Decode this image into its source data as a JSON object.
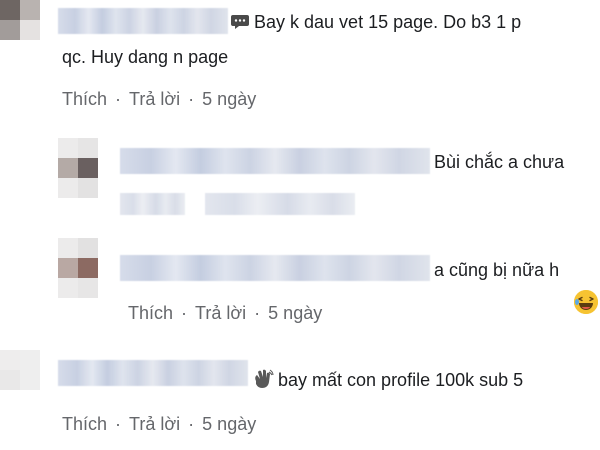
{
  "comments": [
    {
      "text_line1": "Bay k dau vet 15 page. Do b3 1 p",
      "text_line2": "qc. Huy dang n page",
      "icon": "speech-bubble-icon",
      "like": "Thích",
      "reply": "Trả lời",
      "time": "5 ngày"
    },
    {
      "text": "Bùi chắc a chưa"
    },
    {
      "text": "a cũng bị nữa h",
      "like": "Thích",
      "reply": "Trả lời",
      "time": "5 ngày",
      "reaction": "laughing-emoji-icon"
    },
    {
      "text": "bay mất con profile 100k sub 5",
      "icon": "waving-hand-icon",
      "like": "Thích",
      "reply": "Trả lời",
      "time": "5 ngày"
    }
  ],
  "separator": "·"
}
